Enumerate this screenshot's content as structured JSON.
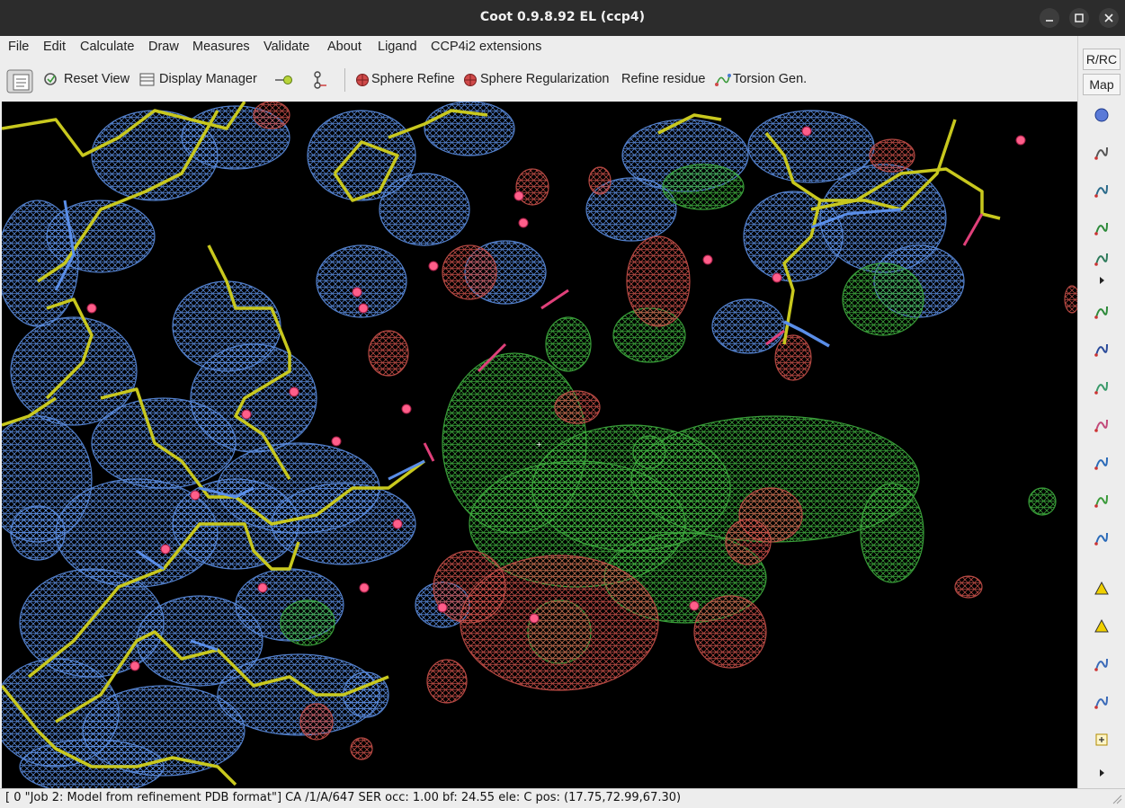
{
  "window": {
    "title": "Coot 0.9.8.92 EL (ccp4)"
  },
  "menu": {
    "file": "File",
    "edit": "Edit",
    "calculate": "Calculate",
    "draw": "Draw",
    "measures": "Measures",
    "validate": "Validate",
    "about": "About",
    "ligand": "Ligand",
    "ccp4i2": "CCP4i2 extensions"
  },
  "toolbar": {
    "reset_view": "Reset View",
    "display_manager": "Display Manager",
    "sphere_refine": "Sphere Refine",
    "sphere_regularization": "Sphere Regularization",
    "refine_residue": "Refine residue",
    "torsion_gen": "Torsion Gen."
  },
  "sidebar": {
    "rrc": "R/RC",
    "map": "Map",
    "icons": [
      "rotate-icon",
      "target-icon",
      "anchor-icon",
      "rigid-body-icon",
      "add-terminal-icon",
      "more-arrow-icon",
      "regularize-icon",
      "flip-icon",
      "backrub-icon",
      "rotamer-icon",
      "edit-chi-icon",
      "side-chain-icon",
      "mutate-icon",
      "add-atom-icon",
      "delete-icon",
      "pointer-icon",
      "undo-icon",
      "place-atom-icon",
      "more-arrow-icon-2"
    ]
  },
  "status": {
    "text": "[ 0 \"Job 2: Model from refinement PDB format\"]  CA /1/A/647 SER occ: 1.00 bf: 24.55 ele:  C pos: (17.75,72.99,67.30)"
  },
  "colors": {
    "map_2fofc": "#5b8de0",
    "map_diff_pos": "#3fae3f",
    "map_diff_neg": "#c8504a",
    "carbon": "#c8c81e",
    "nitrogen": "#5a8ee8",
    "oxygen": "#e0407a"
  }
}
